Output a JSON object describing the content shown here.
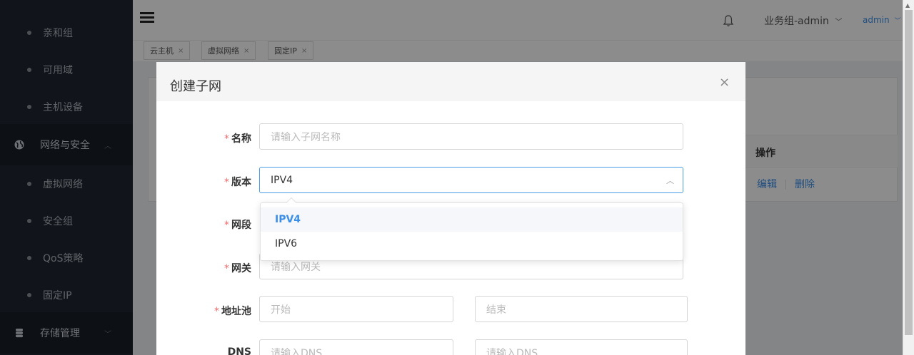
{
  "sidebar": {
    "items": [
      {
        "label": "亲和组",
        "type": "sub"
      },
      {
        "label": "可用域",
        "type": "sub"
      },
      {
        "label": "主机设备",
        "type": "sub"
      },
      {
        "label": "网络与安全",
        "type": "group",
        "icon": "globe-icon"
      },
      {
        "label": "虚拟网络",
        "type": "sub"
      },
      {
        "label": "安全组",
        "type": "sub"
      },
      {
        "label": "QoS策略",
        "type": "sub"
      },
      {
        "label": "固定IP",
        "type": "sub"
      },
      {
        "label": "存储管理",
        "type": "group",
        "icon": "database-icon"
      }
    ]
  },
  "header": {
    "user_group": "业务组-admin",
    "user_name": "admin"
  },
  "tabs": [
    {
      "label": "云主机"
    },
    {
      "label": "虚拟网络"
    },
    {
      "label": "固定IP"
    }
  ],
  "table": {
    "op_header": "操作",
    "row_actions": [
      "编辑",
      "删除"
    ]
  },
  "modal": {
    "title": "创建子网",
    "fields": {
      "name": {
        "label": "名称",
        "placeholder": "请输入子网名称"
      },
      "version": {
        "label": "版本",
        "value": "IPV4",
        "options": [
          "IPV4",
          "IPV6"
        ]
      },
      "segment": {
        "label": "网段"
      },
      "gateway": {
        "label": "网关",
        "placeholder": "请输入网关"
      },
      "pool": {
        "label": "地址池",
        "start_placeholder": "开始",
        "end_placeholder": "结束"
      },
      "dns": {
        "label": "DNS",
        "placeholder1": "请输入DNS",
        "placeholder2": "请输入DNS"
      }
    }
  },
  "colors": {
    "sidebar_bg": "#1f2630",
    "accent": "#3b8ee8",
    "required": "#f56c6c"
  }
}
